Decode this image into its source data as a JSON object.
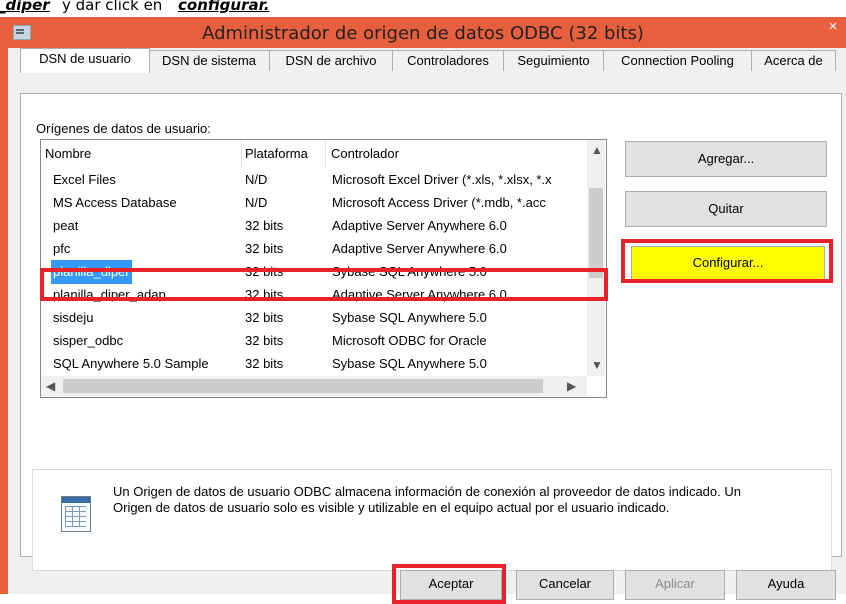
{
  "caption": {
    "left_text": "_diper",
    "middle_text": " y dar click en ",
    "right_text": "configurar."
  },
  "window": {
    "title": "Administrador de origen de datos ODBC (32 bits)",
    "close_glyph": "×"
  },
  "tabs": [
    {
      "label": "DSN de usuario"
    },
    {
      "label": "DSN de sistema"
    },
    {
      "label": "DSN de archivo"
    },
    {
      "label": "Controladores"
    },
    {
      "label": "Seguimiento"
    },
    {
      "label": "Connection Pooling"
    },
    {
      "label": "Acerca de"
    }
  ],
  "list": {
    "label": "Orígenes de datos de usuario:",
    "columns": {
      "name": "Nombre",
      "platform": "Plataforma",
      "driver": "Controlador"
    },
    "rows": [
      {
        "name": "Excel Files",
        "platform": "N/D",
        "driver": "Microsoft Excel Driver (*.xls, *.xlsx, *.x"
      },
      {
        "name": "MS Access Database",
        "platform": "N/D",
        "driver": "Microsoft Access Driver (*.mdb, *.acc"
      },
      {
        "name": "peat",
        "platform": "32 bits",
        "driver": "Adaptive Server Anywhere 6.0"
      },
      {
        "name": "pfc",
        "platform": "32 bits",
        "driver": "Adaptive Server Anywhere 6.0"
      },
      {
        "name": "planilla_diper",
        "platform": "32 bits",
        "driver": "Sybase SQL Anywhere 5.0",
        "selected": true
      },
      {
        "name": "planilla_diper_adap",
        "platform": "32 bits",
        "driver": "Adaptive Server Anywhere 6.0"
      },
      {
        "name": "sisdeju",
        "platform": "32 bits",
        "driver": "Sybase SQL Anywhere 5.0"
      },
      {
        "name": "sisper_odbc",
        "platform": "32 bits",
        "driver": "Microsoft ODBC for Oracle"
      },
      {
        "name": "SQL Anywhere 5.0 Sample",
        "platform": "32 bits",
        "driver": "Sybase SQL Anywhere 5.0"
      }
    ]
  },
  "buttons": {
    "add": "Agregar...",
    "remove": "Quitar",
    "configure": "Configurar...",
    "ok": "Aceptar",
    "cancel": "Cancelar",
    "apply": "Aplicar",
    "help": "Ayuda"
  },
  "info": {
    "text": "Un Origen de datos de usuario ODBC almacena información de conexión al proveedor de datos indicado. Un Origen de datos de usuario solo es visible y utilizable en el equipo actual por el usuario indicado."
  },
  "colors": {
    "frame": "#e85f3d",
    "highlight": "#e8212b",
    "configure_bg": "#ffff00",
    "selection": "#3399ff"
  }
}
